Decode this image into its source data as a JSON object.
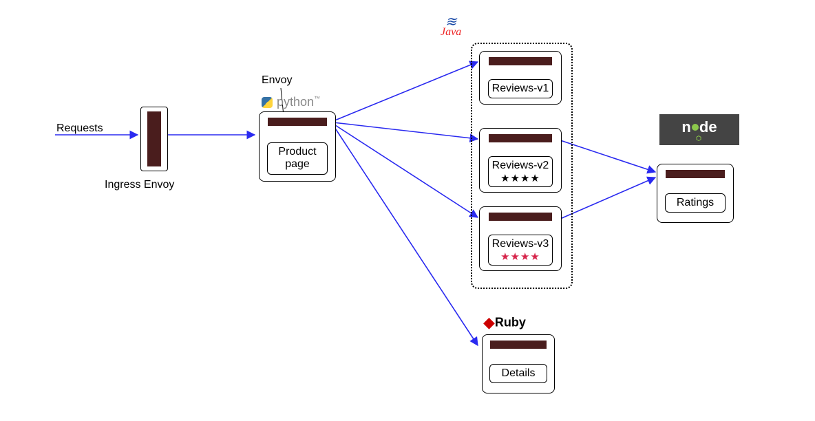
{
  "labels": {
    "requests": "Requests",
    "envoy": "Envoy",
    "ingress": "Ingress Envoy",
    "python": "python",
    "java": "Java",
    "ruby": "Ruby",
    "node_left": "n",
    "node_right": "de"
  },
  "services": {
    "product": "Product page",
    "reviews_v1": "Reviews-v1",
    "reviews_v2": "Reviews-v2",
    "reviews_v3": "Reviews-v3",
    "ratings": "Ratings",
    "details": "Details"
  },
  "stars": {
    "black4": "★★★★",
    "red4": "★★★★"
  }
}
